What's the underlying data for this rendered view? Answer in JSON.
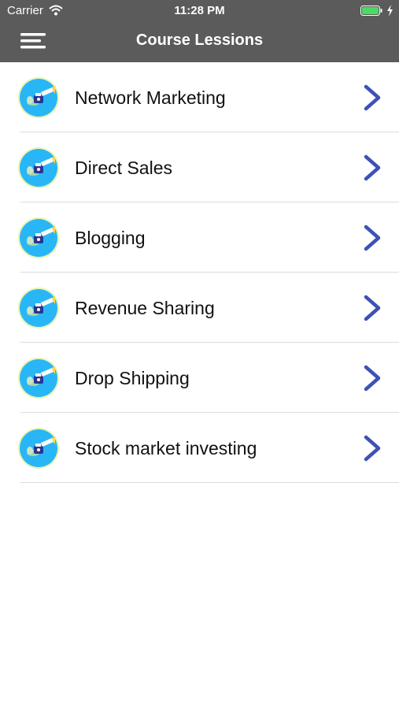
{
  "status_bar": {
    "carrier": "Carrier",
    "time": "11:28 PM"
  },
  "nav": {
    "title": "Course Lessions",
    "menu_icon": "hamburger-menu-icon"
  },
  "colors": {
    "bar": "#5b5b5b",
    "chevron": "#3f51b5",
    "avatar_bg": "#29b6f6",
    "battery": "#4cd964"
  },
  "lessons": [
    {
      "label": "Network Marketing"
    },
    {
      "label": "Direct Sales"
    },
    {
      "label": "Blogging"
    },
    {
      "label": "Revenue Sharing"
    },
    {
      "label": "Drop Shipping"
    },
    {
      "label": "Stock market investing"
    }
  ]
}
